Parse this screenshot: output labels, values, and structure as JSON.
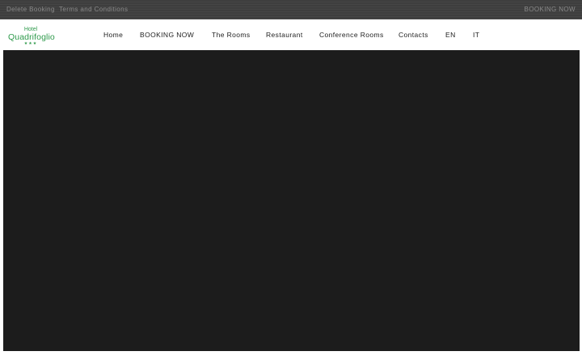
{
  "topbar": {
    "delete_booking": "Delete Booking",
    "terms": "Terms and Conditions",
    "booking_now": "BOOKING NOW"
  },
  "logo": {
    "hotel": "Hotel",
    "name": "Quadrifoglio",
    "stars": "★★★"
  },
  "nav": {
    "items": [
      "Home",
      "BOOKING NOW",
      "The Rooms",
      "Restaurant",
      "Conference Rooms",
      "Contacts",
      "EN",
      "IT"
    ]
  },
  "colors": {
    "brand_green": "#2e9a4b",
    "topbar_bg": "#3e3e3e",
    "hero_bg": "#1c1c1c"
  }
}
